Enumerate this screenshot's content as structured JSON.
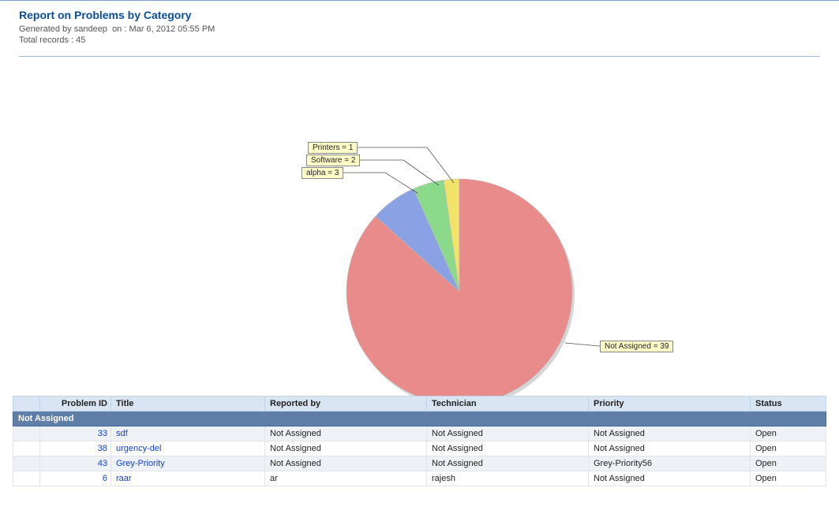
{
  "header": {
    "title": "Report on Problems by Category",
    "generated_by_label": "Generated by",
    "generated_by_user": "sandeep",
    "generated_on_label": "on :",
    "generated_on": "Mar 6, 2012 05:55 PM",
    "total_records_label": "Total records :",
    "total_records": "45"
  },
  "chart_data": {
    "type": "pie",
    "title": "",
    "series": [
      {
        "name": "Printers",
        "value": 1,
        "color": "#f1e26a"
      },
      {
        "name": "Software",
        "value": 2,
        "color": "#8bd98b"
      },
      {
        "name": "alpha",
        "value": 3,
        "color": "#8aa1e3"
      },
      {
        "name": "Not Assigned",
        "value": 39,
        "color": "#e98b8b"
      }
    ],
    "total": 45,
    "labels": {
      "printers": "Printers = 1",
      "software": "Software = 2",
      "alpha": "alpha = 3",
      "not_assigned": "Not Assigned = 39"
    }
  },
  "table": {
    "columns": {
      "blank": "",
      "problem_id": "Problem ID",
      "title": "Title",
      "reported_by": "Reported by",
      "technician": "Technician",
      "priority": "Priority",
      "status": "Status"
    },
    "group_label": "Not Assigned",
    "rows": [
      {
        "id": "33",
        "title": "sdf",
        "reported_by": "Not Assigned",
        "technician": "Not Assigned",
        "priority": "Not Assigned",
        "status": "Open"
      },
      {
        "id": "38",
        "title": "urgency-del",
        "reported_by": "Not Assigned",
        "technician": "Not Assigned",
        "priority": "Not Assigned",
        "status": "Open"
      },
      {
        "id": "43",
        "title": "Grey-Priority",
        "reported_by": "Not Assigned",
        "technician": "Not Assigned",
        "priority": "Grey-Priority56",
        "status": "Open"
      },
      {
        "id": "6",
        "title": "raar",
        "reported_by": "ar",
        "technician": "rajesh",
        "priority": "Not Assigned",
        "status": "Open"
      }
    ]
  }
}
